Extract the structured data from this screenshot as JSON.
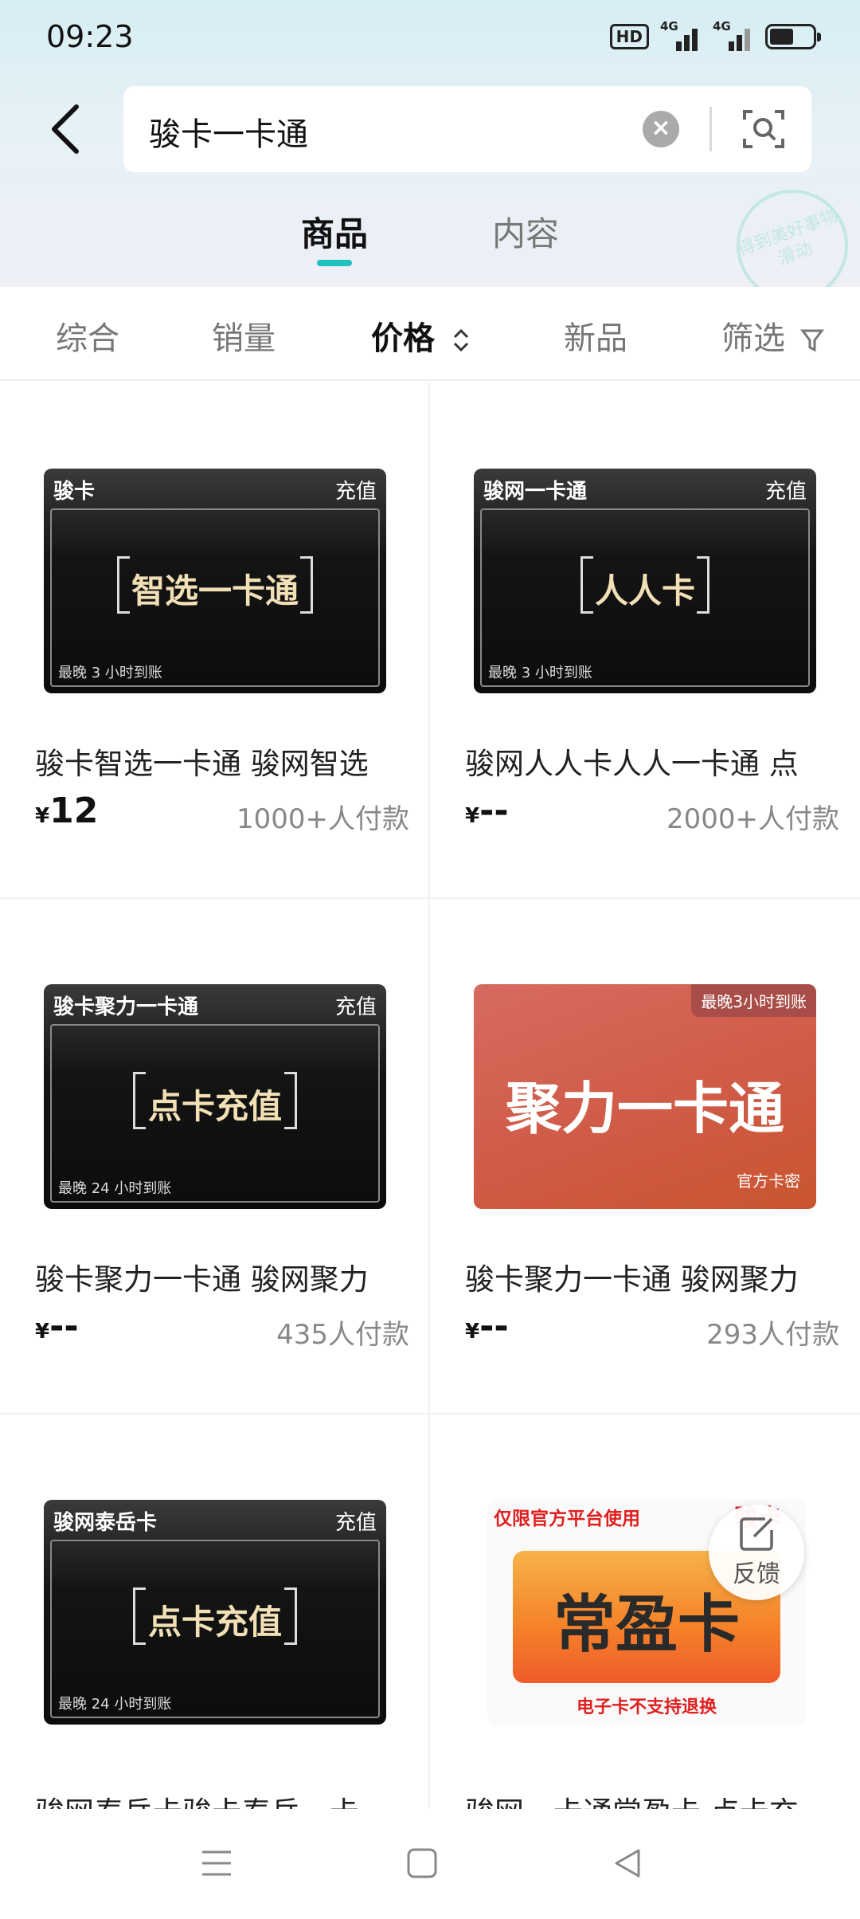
{
  "status": {
    "time": "09:23",
    "hd": "HD",
    "sig1": "4G",
    "sig2": "4G"
  },
  "search": {
    "query": "骏卡一卡通"
  },
  "tabs": [
    {
      "label": "商品",
      "active": true
    },
    {
      "label": "内容",
      "active": false
    }
  ],
  "stamp": {
    "text": "得到美好事物\n滑动"
  },
  "sort": [
    "综合",
    "销量",
    "价格",
    "新品",
    "筛选"
  ],
  "products": [
    {
      "title": "骏卡智选一卡通 骏网智选",
      "price": "12",
      "currency": "¥",
      "pay": "1000+人付款",
      "img": {
        "style": "dark",
        "top_left": "骏卡",
        "top_right": "充值",
        "center": "智选一卡通",
        "note": "最晚 3 小时到账"
      }
    },
    {
      "title": "骏网人人卡人人一卡通 点",
      "price": "--",
      "currency": "¥",
      "pay": "2000+人付款",
      "img": {
        "style": "dark",
        "top_left": "骏网一卡通",
        "top_right": "充值",
        "center": "人人卡",
        "note": "最晚 3 小时到账"
      }
    },
    {
      "title": "骏卡聚力一卡通 骏网聚力",
      "price": "--",
      "currency": "¥",
      "pay": "435人付款",
      "img": {
        "style": "dark",
        "top_left": "骏卡聚力一卡通",
        "top_right": "充值",
        "center": "点卡充值",
        "note": "最晚 24 小时到账"
      }
    },
    {
      "title": "骏卡聚力一卡通 骏网聚力",
      "price": "--",
      "currency": "¥",
      "pay": "293人付款",
      "img": {
        "style": "red",
        "badge": "最晚3小时到账",
        "center": "聚力一卡通",
        "note": "官方卡密"
      }
    },
    {
      "title": "骏网泰岳卡骏卡泰岳一卡",
      "price": "",
      "currency": "",
      "pay": "",
      "img": {
        "style": "dark",
        "top_left": "骏网泰岳卡",
        "top_right": "充值",
        "center": "点卡充值",
        "note": "最晚 24 小时到账"
      }
    },
    {
      "title": "骏网一卡通常盈卡 点卡充",
      "price": "",
      "currency": "",
      "pay": "",
      "img": {
        "style": "white",
        "top_left": "仅限官方平台使用",
        "top_right": "骏卡",
        "center": "常盈卡",
        "note": "电子卡不支持退换"
      }
    }
  ],
  "feedback": {
    "label": "反馈"
  }
}
